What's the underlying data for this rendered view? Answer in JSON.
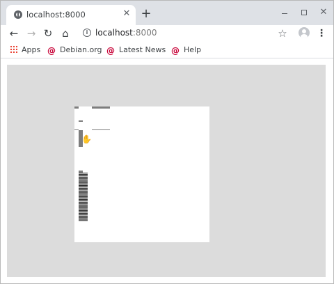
{
  "tab": {
    "title": "localhost:8000",
    "close_glyph": "✕",
    "favicon": "globe-icon"
  },
  "new_tab_glyph": "+",
  "window_controls": {
    "close_glyph": "✕"
  },
  "toolbar": {
    "back_glyph": "←",
    "forward_glyph": "→",
    "reload_glyph": "↻",
    "home_glyph": "⌂",
    "info_glyph": "i",
    "url_host": "localhost",
    "url_port": ":8000",
    "star_glyph": "☆",
    "menu_glyph": "⋮"
  },
  "bookmarks": [
    {
      "label": "Apps",
      "icon": "apps-grid-icon"
    },
    {
      "label": "Debian.org",
      "icon": "debian-swirl-icon"
    },
    {
      "label": "Latest News",
      "icon": "debian-swirl-icon"
    },
    {
      "label": "Help",
      "icon": "debian-swirl-icon"
    }
  ],
  "content": {
    "canvas_color": "#dcdcdc",
    "document_color": "#ffffff",
    "cursor_glyph": "✋"
  },
  "colors": {
    "tabstrip": "#dee1e6",
    "debian_red": "#c70036"
  }
}
